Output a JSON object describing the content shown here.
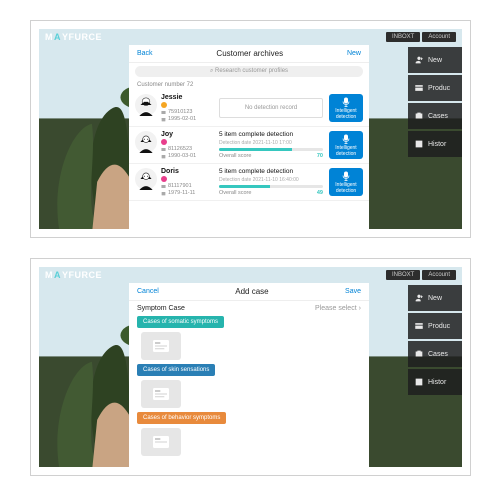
{
  "brand_pre": "M",
  "brand_accent": "A",
  "brand_post": "YFURCE",
  "topchips": {
    "inbox": "INBOXT",
    "account": "Account"
  },
  "nav": {
    "new": "New",
    "product": "Produc",
    "cases": "Cases",
    "history": "Histor"
  },
  "archives": {
    "back": "Back",
    "title": "Customer archives",
    "new": "New",
    "search_placeholder": "Research customer profiles",
    "count_label": "Customer number 72",
    "no_detection": "No detection record",
    "id_button": "Intelligent detection",
    "score_label": "Overall score",
    "rows": [
      {
        "name": "Jessie",
        "phone": "75910123",
        "dob": "1995-02-01"
      },
      {
        "name": "Joy",
        "phone": "81126523",
        "dob": "1990-03-01",
        "detection_title": "5 item complete detection",
        "detection_date": "Detection date  2021-11-10 17:00",
        "score": 70
      },
      {
        "name": "Doris",
        "phone": "81117901",
        "dob": "1979-11-11",
        "detection_title": "5 item complete detection",
        "detection_date": "Detection date  2021-11-10 16:40:00",
        "score": 49
      }
    ]
  },
  "addcase": {
    "cancel": "Cancel",
    "title": "Add case",
    "save": "Save",
    "section_label": "Symptom Case",
    "section_hint": "Please select",
    "cats": {
      "a": "Cases of somatic symptoms",
      "b": "Cases of skin sensations",
      "c": "Cases of behavior symptoms"
    }
  }
}
